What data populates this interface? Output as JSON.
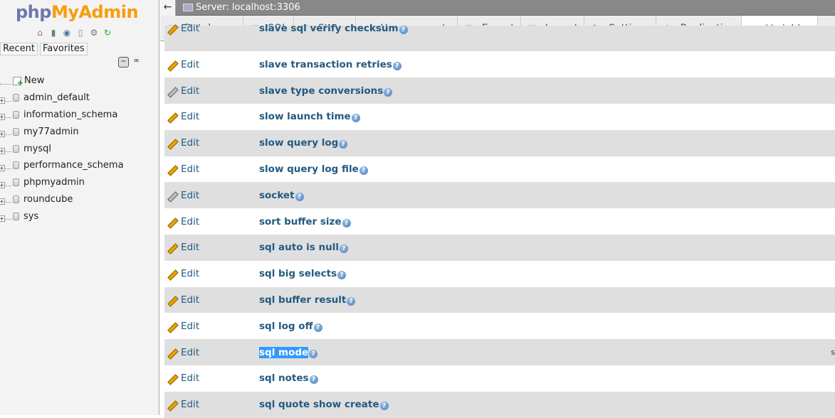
{
  "nav": {
    "logo_php": "php",
    "logo_my": "My",
    "logo_admin": "Admin",
    "tab_recent": "Recent",
    "tab_favorites": "Favorites",
    "new_label": "New",
    "databases": [
      "admin_default",
      "information_schema",
      "my77admin",
      "mysql",
      "performance_schema",
      "phpmyadmin",
      "roundcube",
      "sys"
    ]
  },
  "topbar": {
    "back": "←",
    "crumb": "Server: localhost:3306"
  },
  "tabs": [
    {
      "label": "Databases",
      "icon": "database-icon",
      "glyph": "▤"
    },
    {
      "label": "SQL",
      "icon": "sql-icon",
      "glyph": "▦"
    },
    {
      "label": "Status",
      "icon": "status-icon",
      "glyph": "▥"
    },
    {
      "label": "User accounts",
      "icon": "users-icon",
      "glyph": "▭"
    },
    {
      "label": "Export",
      "icon": "export-icon",
      "glyph": "▣"
    },
    {
      "label": "Import",
      "icon": "import-icon",
      "glyph": "▣"
    },
    {
      "label": "Settings",
      "icon": "wrench-icon",
      "glyph": "✎"
    },
    {
      "label": "Replication",
      "icon": "replication-icon",
      "glyph": "⊥"
    },
    {
      "label": "Variables",
      "icon": "variables-icon",
      "glyph": "◈"
    }
  ],
  "more_glyph": "≡",
  "variables": {
    "edit_label": "Edit",
    "help_glyph": "?",
    "rows": [
      {
        "name": "slave sql verify checksum",
        "value": ""
      },
      {
        "name": "slave transaction retries",
        "value": ""
      },
      {
        "name": "slave type conversions",
        "value": ""
      },
      {
        "name": "slow launch time",
        "value": ""
      },
      {
        "name": "slow query log",
        "value": ""
      },
      {
        "name": "slow query log file",
        "value": ""
      },
      {
        "name": "socket",
        "value": ""
      },
      {
        "name": "sort buffer size",
        "value": ""
      },
      {
        "name": "sql auto is null",
        "value": ""
      },
      {
        "name": "sql big selects",
        "value": ""
      },
      {
        "name": "sql buffer result",
        "value": ""
      },
      {
        "name": "sql log off",
        "value": ""
      },
      {
        "name": "sql mode",
        "value": "s"
      },
      {
        "name": "sql notes",
        "value": ""
      },
      {
        "name": "sql quote show create",
        "value": ""
      }
    ]
  }
}
